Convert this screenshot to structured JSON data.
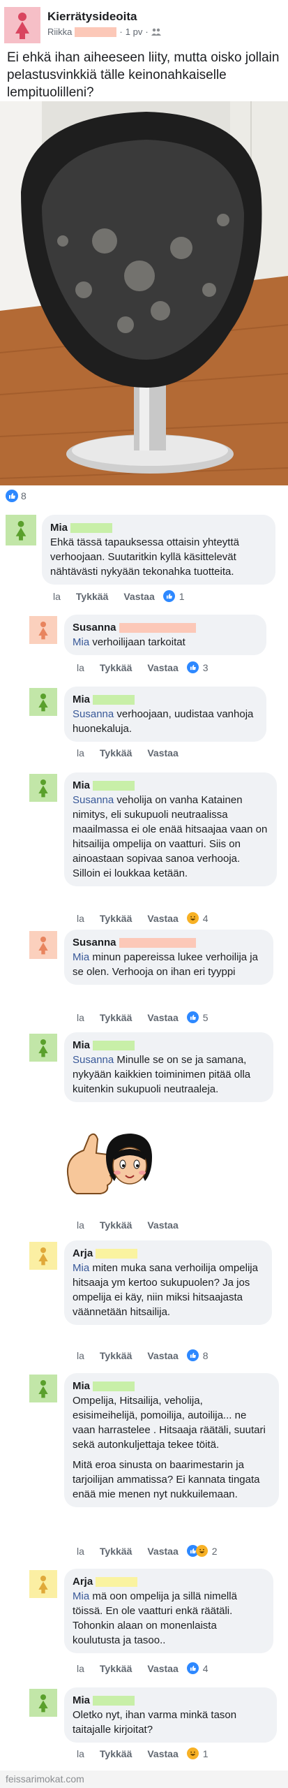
{
  "post": {
    "group_name": "Kierrätysideoita",
    "author": "Riikka",
    "time": "1 pv",
    "separator": "·",
    "text": "Ei ehkä ihan aiheeseen liity, mutta oisko jollain pelastusvinkkiä tälle keinonahkaiselle lempituolilleni?",
    "reaction_count": "8"
  },
  "actions": {
    "la": "la",
    "like": "Tykkää",
    "reply": "Vastaa"
  },
  "comments": [
    {
      "name": "Mia",
      "lines": [
        "Ehkä tässä tapauksessa ottaisin yhteyttä verhoojaan. Suutaritkin kyllä käsittelevät nähtävästi nykyään tekonahka tuotteita."
      ],
      "reactions": "1"
    },
    {
      "name": "Susanna",
      "mention": "Mia",
      "lines": [
        "verhoilijaan tarkoitat"
      ],
      "reactions": "3"
    },
    {
      "name": "Mia",
      "mention": "Susanna",
      "lines": [
        "verhoojaan, uudistaa vanhoja huonekaluja."
      ],
      "reactions": ""
    },
    {
      "name": "Mia",
      "mention": "Susanna",
      "lines": [
        "veholija on vanha Katainen nimitys, eli sukupuoli neutraalissa maailmassa ei ole enää hitsaajaa vaan on hitsailija ompelija on vaatturi. Siis on ainoastaan sopivaa sanoa verhooja. Silloin ei loukkaa ketään."
      ],
      "reactions": "4"
    },
    {
      "name": "Susanna",
      "mention": "Mia",
      "lines": [
        "minun papereissa lukee verhoilija ja se olen. Verhooja on ihan eri tyyppi"
      ],
      "reactions": "5"
    },
    {
      "name": "Mia",
      "mention": "Susanna",
      "lines": [
        "Minulle se on se ja samana,  nykyään kaikkien toiminimen pitää olla kuitenkin sukupuoli neutraaleja."
      ],
      "reactions": ""
    },
    {
      "name": "Arja",
      "mention": "Mia",
      "lines": [
        "miten muka sana verhoilija ompelija hitsaaja ym kertoo sukupuolen?  Ja jos ompelija ei käy, niin miksi hitsaajasta väännetään hitsailija."
      ],
      "reactions": "8"
    },
    {
      "name": "Mia",
      "lines": [
        "Ompelija, Hitsailija, veholija, esisimeihelijä, pomoilija, autoilija... ne vaan harrastelee . Hitsaaja räätäli, suutari  sekä autonkuljettaja tekee töitä.",
        "Mitä eroa sinusta on baarimestarin ja tarjoilijan ammatissa?  Ei kannata tingata enää mie menen nyt nukkuilemaan."
      ],
      "reactions": "2"
    },
    {
      "name": "Arja",
      "mention": "Mia",
      "lines": [
        "mä oon ompelija ja sillä nimellä töissä. En ole vaatturi enkä räätäli. Tohonkin alaan on monenlaista koulutusta ja tasoo.."
      ],
      "reactions": "4"
    },
    {
      "name": "Mia",
      "lines": [
        "Oletko nyt, ihan varma minkä tason taitajalle  kirjoitat?"
      ],
      "reactions": "1"
    }
  ],
  "footer": "feissarimokat.com",
  "colors": {
    "link": "#385898",
    "like_blue": "#2d88ff",
    "haha_yellow": "#f7b125",
    "bubble": "#f0f2f5"
  }
}
